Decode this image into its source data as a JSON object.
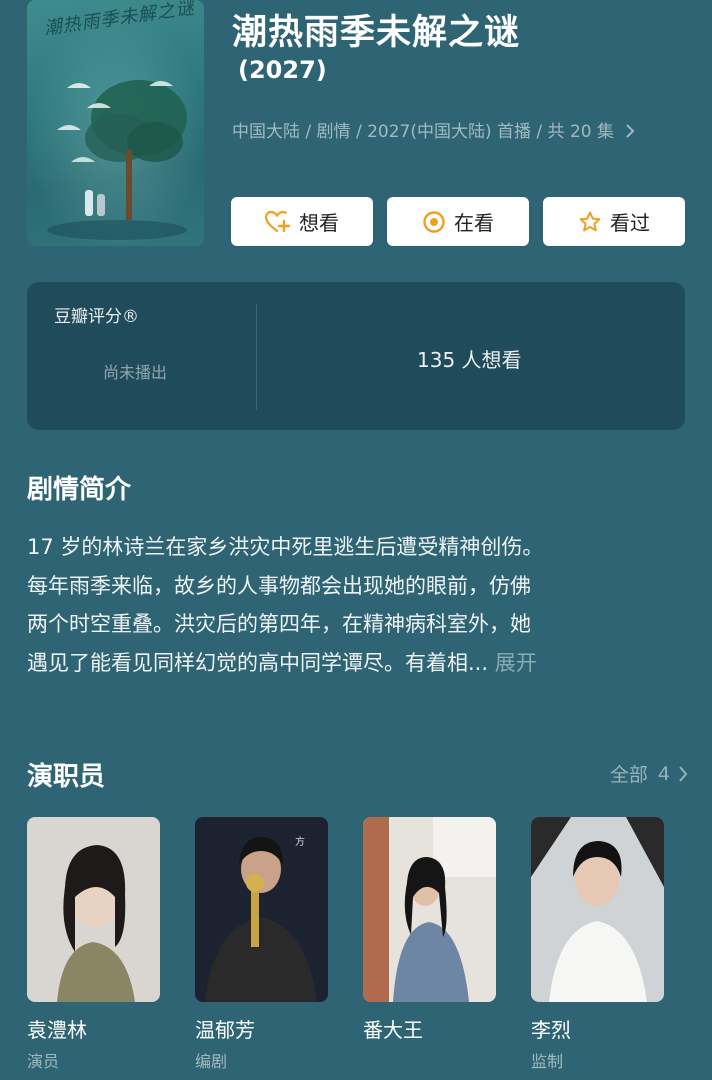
{
  "show": {
    "title": "潮热雨季未解之谜",
    "year": "(2027)",
    "meta": "中国大陆 / 剧情 / 2027(中国大陆) 首播 / 共 20 集",
    "poster_title": "潮热雨季未解之谜"
  },
  "actions": {
    "want": "想看",
    "watching": "在看",
    "watched": "看过"
  },
  "rating": {
    "label": "豆瓣评分®",
    "status": "尚未播出",
    "want_count": "135 人想看"
  },
  "synopsis": {
    "heading": "剧情简介",
    "lines": [
      "17 岁的林诗兰在家乡洪灾中死里逃生后遭受精神创伤。",
      "每年雨季来临，故乡的人事物都会出现她的眼前，仿佛",
      "两个时空重叠。洪灾后的第四年，在精神病科室外，她",
      "遇见了能看见同样幻觉的高中同学谭尽。有着相..."
    ],
    "expand": "展开"
  },
  "cast": {
    "heading": "演职员",
    "all_label": "全部",
    "all_count": "4",
    "members": [
      {
        "name": "袁澧林",
        "role": "演员"
      },
      {
        "name": "温郁芳",
        "role": "编剧"
      },
      {
        "name": "番大王",
        "role": ""
      },
      {
        "name": "李烈",
        "role": "监制"
      }
    ]
  },
  "colors": {
    "background": "#2e6474",
    "want_icon": "#f0a020",
    "watching_icon": "#f0a020",
    "watched_icon": "#f0a020"
  },
  "icons": {
    "want": "heart-plus-icon",
    "watching": "target-icon",
    "watched": "star-outline-icon",
    "meta_more": "chevron-right-icon",
    "cast_more": "chevron-right-icon"
  }
}
